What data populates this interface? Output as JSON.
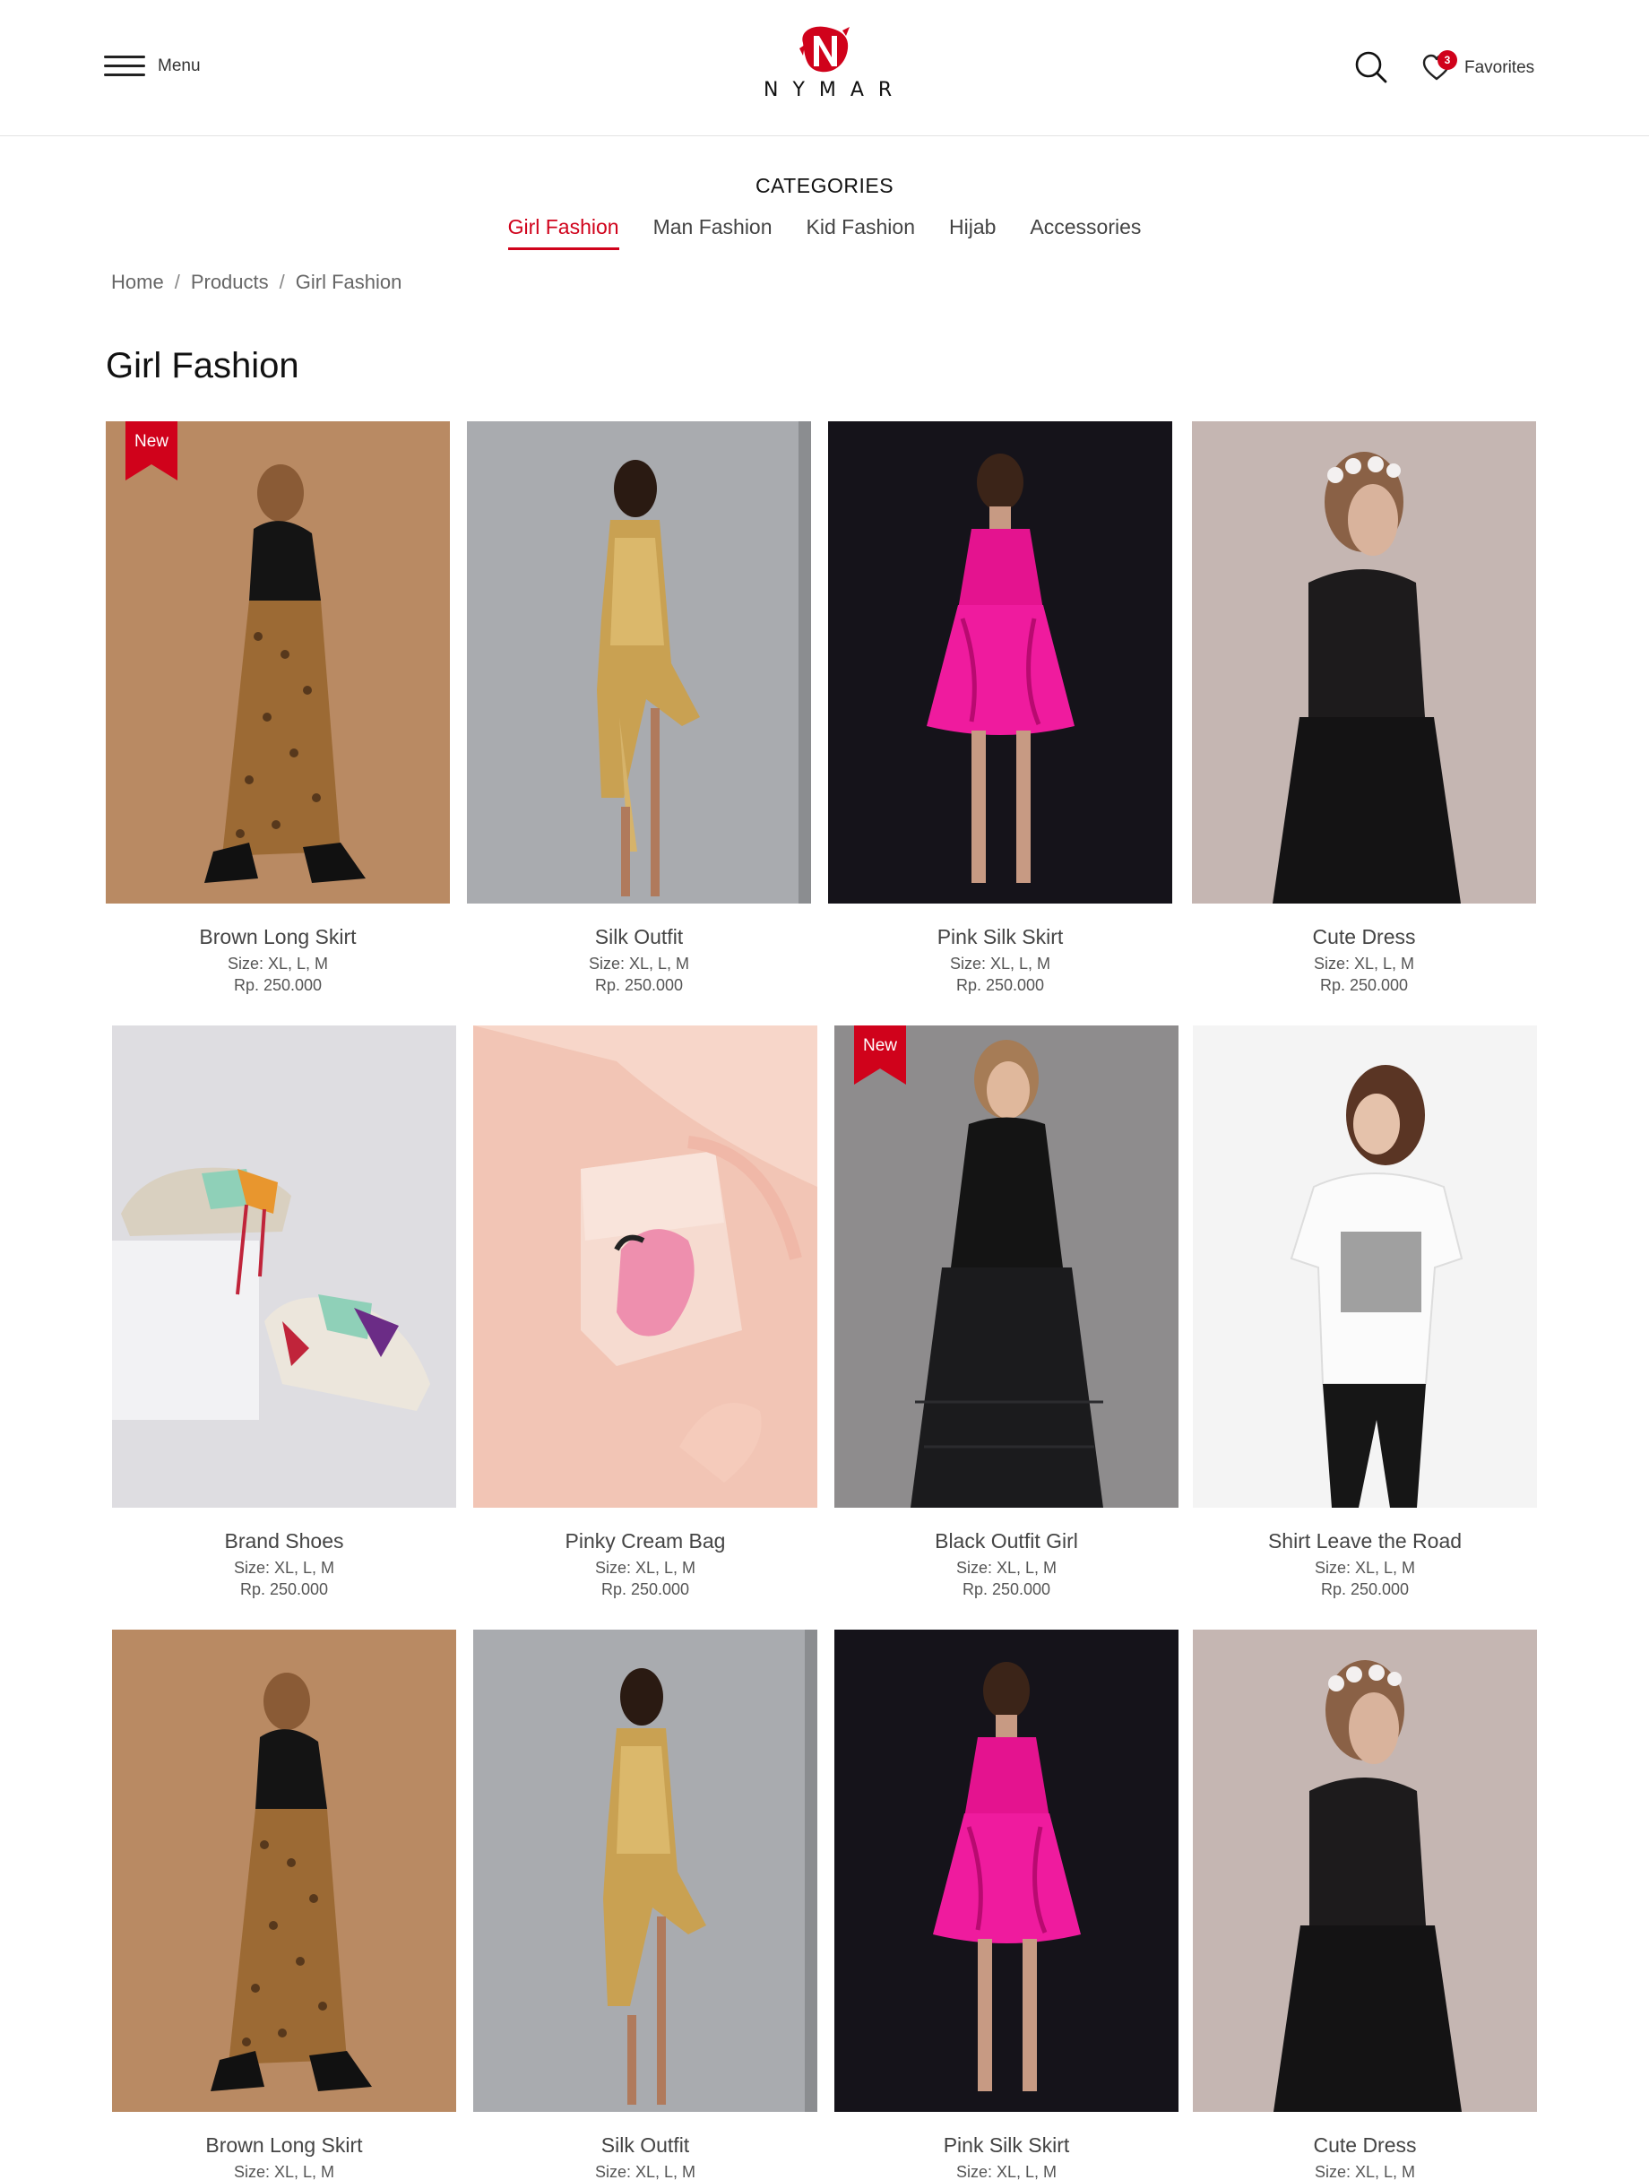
{
  "header": {
    "menu_label": "Menu",
    "logo_text": "NYMAR",
    "favorites_label": "Favorites",
    "favorites_count": "3",
    "brand_color": "#d0021b"
  },
  "categories": {
    "title": "CATEGORIES",
    "tabs": [
      {
        "label": "Girl Fashion",
        "active": true
      },
      {
        "label": "Man Fashion",
        "active": false
      },
      {
        "label": "Kid Fashion",
        "active": false
      },
      {
        "label": "Hijab",
        "active": false
      },
      {
        "label": "Accessories",
        "active": false
      }
    ]
  },
  "breadcrumb": [
    "Home",
    "Products",
    "Girl Fashion"
  ],
  "page_title": "Girl Fashion",
  "products": [
    {
      "name": "Brown Long Skirt",
      "size": "Size: XL, L, M",
      "price": "Rp. 250.000",
      "badge": "New",
      "image": "woman-leopard-skirt"
    },
    {
      "name": "Silk Outfit",
      "size": "Size: XL, L, M",
      "price": "Rp. 250.000",
      "badge": "",
      "image": "woman-gold-dress"
    },
    {
      "name": "Pink Silk Skirt",
      "size": "Size: XL, L, M",
      "price": "Rp. 250.000",
      "badge": "",
      "image": "woman-pink-dress"
    },
    {
      "name": "Cute Dress",
      "size": "Size: XL, L, M",
      "price": "Rp. 250.000",
      "badge": "",
      "image": "woman-black-lace-dress"
    },
    {
      "name": "Brand Shoes",
      "size": "Size: XL, L, M",
      "price": "Rp. 250.000",
      "badge": "",
      "image": "sneakers"
    },
    {
      "name": "Pinky Cream Bag",
      "size": "Size: XL, L, M",
      "price": "Rp. 250.000",
      "badge": "",
      "image": "flamingo-bag"
    },
    {
      "name": "Black Outfit Girl",
      "size": "Size: XL, L, M",
      "price": "Rp. 250.000",
      "badge": "New",
      "image": "woman-black-outfit"
    },
    {
      "name": "Shirt Leave the Road",
      "size": "Size: XL, L, M",
      "price": "Rp. 250.000",
      "badge": "",
      "image": "woman-white-tshirt"
    },
    {
      "name": "Brown Long Skirt",
      "size": "Size: XL, L, M",
      "price": "",
      "badge": "",
      "image": "woman-leopard-skirt"
    },
    {
      "name": "Silk Outfit",
      "size": "Size: XL, L, M",
      "price": "",
      "badge": "",
      "image": "woman-gold-dress"
    },
    {
      "name": "Pink Silk Skirt",
      "size": "Size: XL, L, M",
      "price": "",
      "badge": "",
      "image": "woman-pink-dress"
    },
    {
      "name": "Cute Dress",
      "size": "Size: XL, L, M",
      "price": "",
      "badge": "",
      "image": "woman-black-lace-dress"
    }
  ]
}
